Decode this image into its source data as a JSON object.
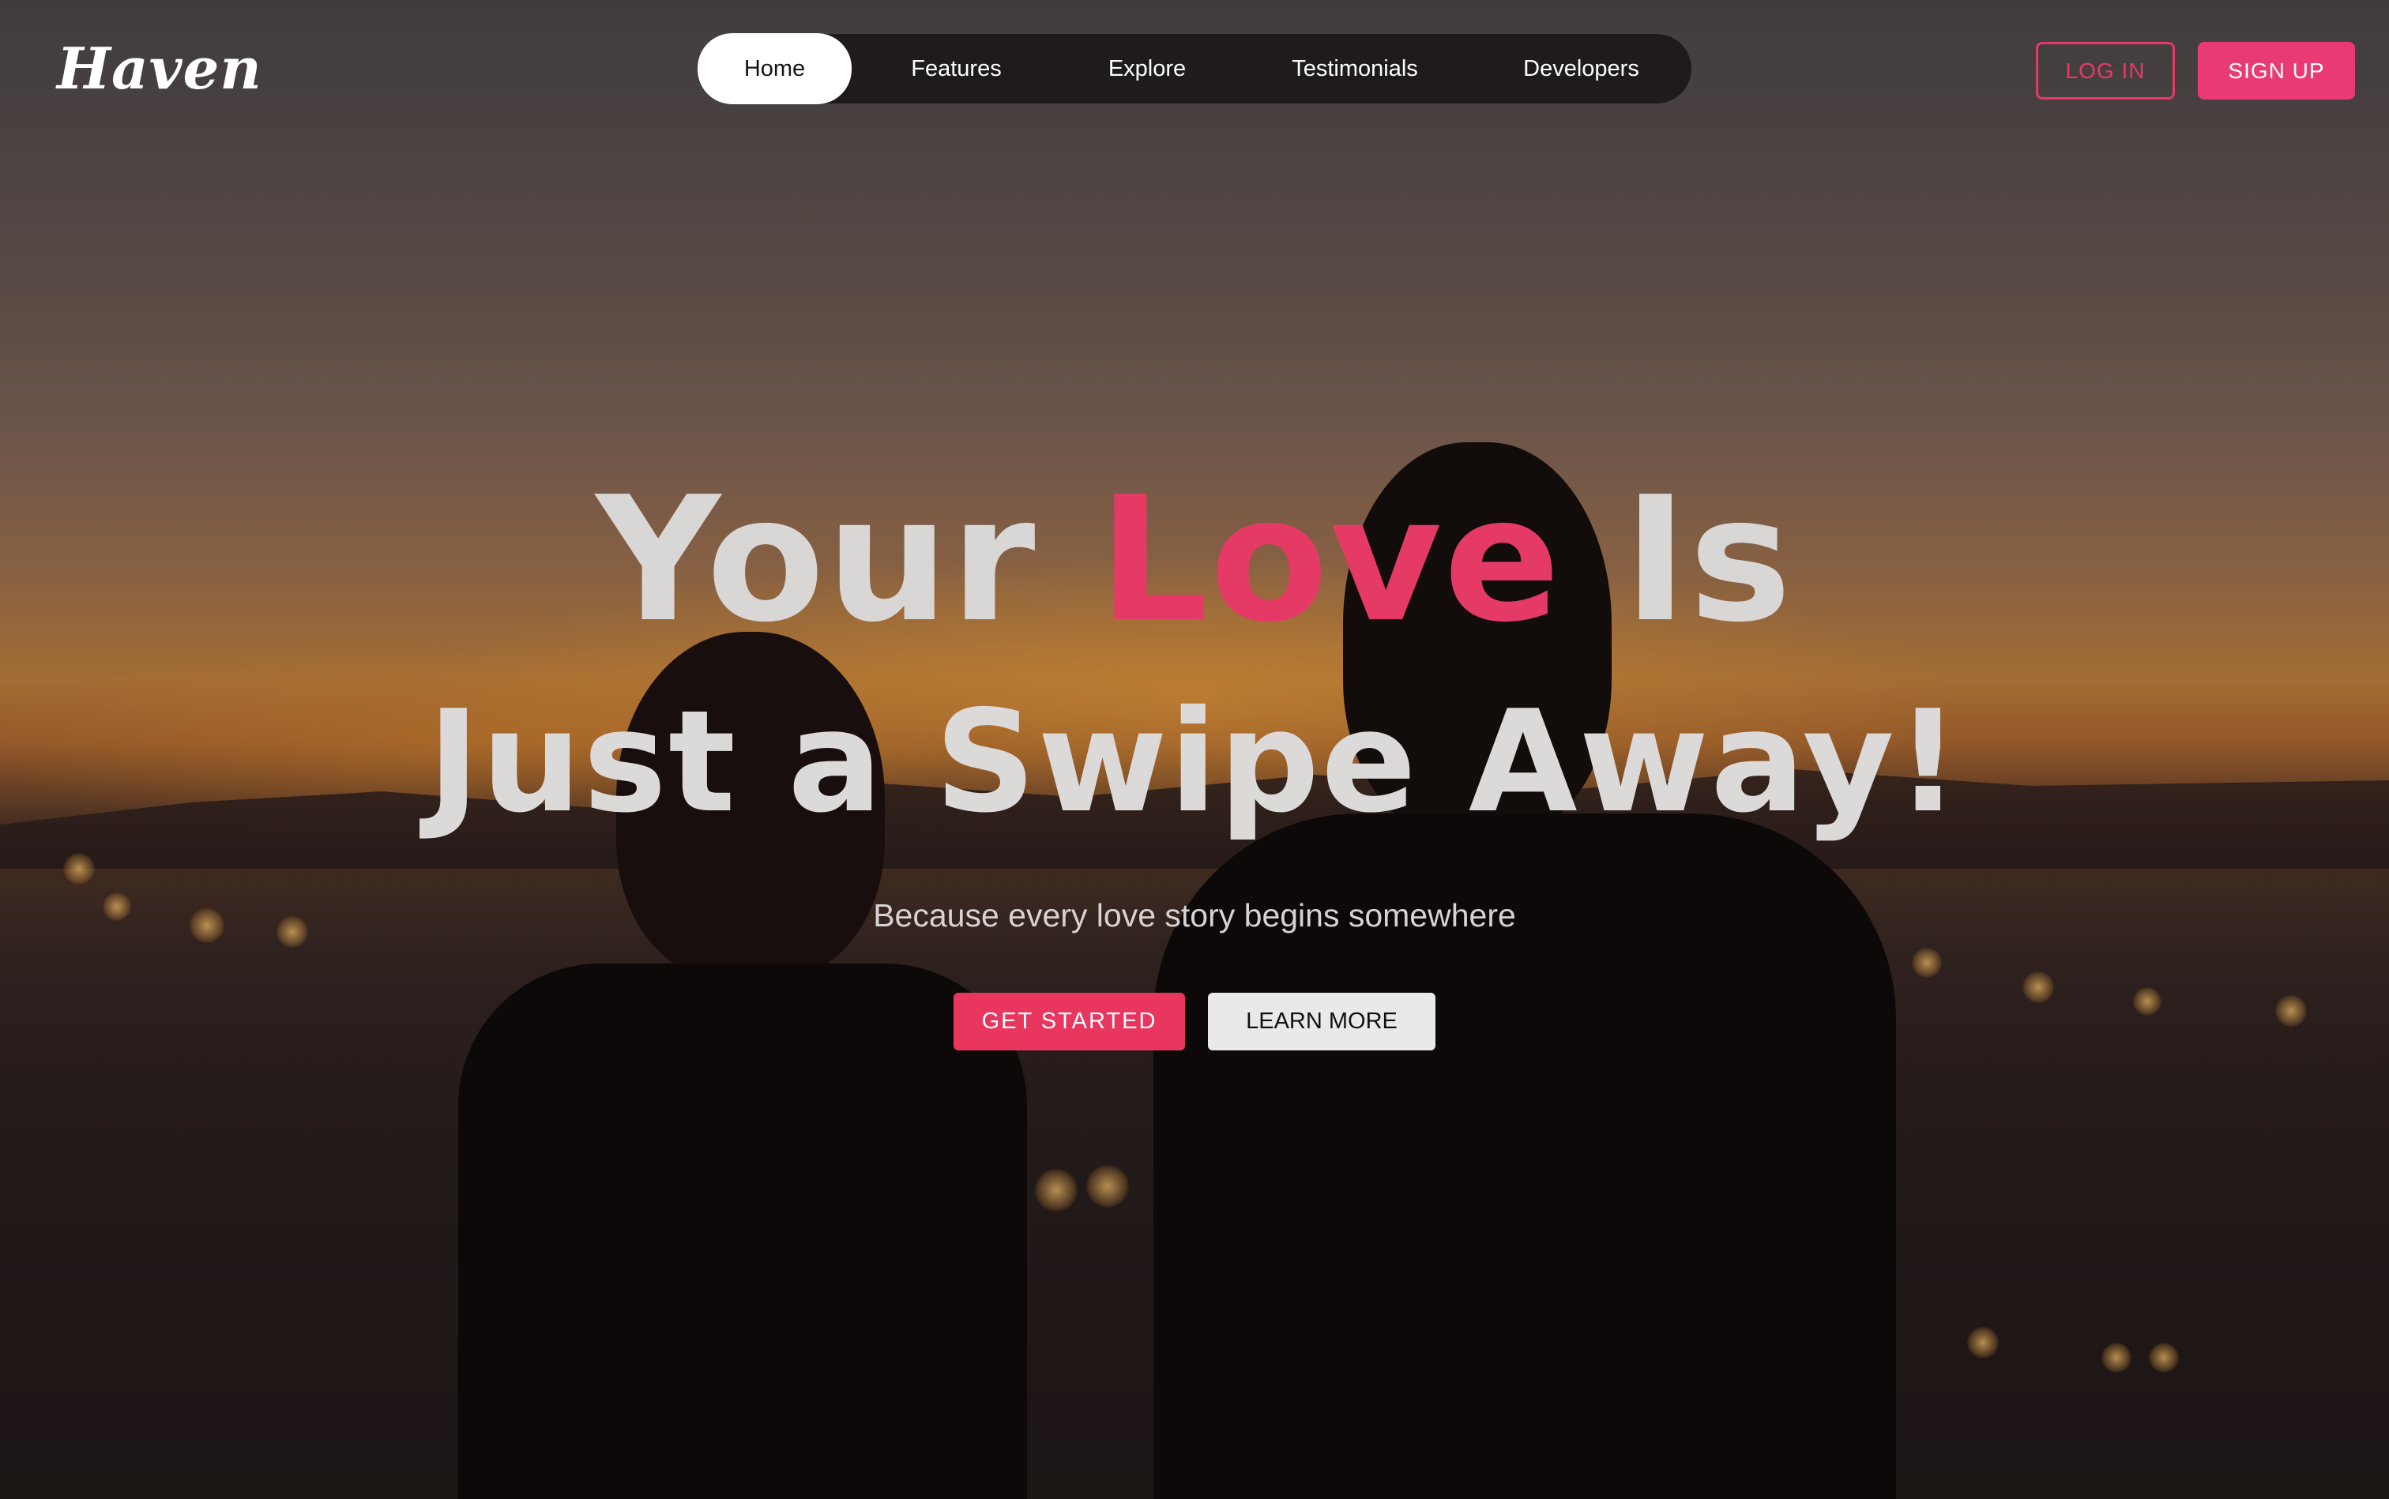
{
  "brand": {
    "logo": "Haven"
  },
  "nav": {
    "items": [
      {
        "label": "Home",
        "active": true
      },
      {
        "label": "Features",
        "active": false
      },
      {
        "label": "Explore",
        "active": false
      },
      {
        "label": "Testimonials",
        "active": false
      },
      {
        "label": "Developers",
        "active": false
      }
    ]
  },
  "auth": {
    "login_label": "LOG IN",
    "signup_label": "SIGN UP"
  },
  "hero": {
    "headline_part1": "Your ",
    "headline_highlight": "Love",
    "headline_part2": " Is",
    "headline_line2": "Just a Swipe Away!",
    "tagline": "Because every love story begins somewhere",
    "cta_primary": "GET STARTED",
    "cta_secondary": "LEARN MORE"
  },
  "colors": {
    "accent": "#e8386a",
    "nav_bg": "#1c1818",
    "text_light": "#d9d6d6"
  }
}
